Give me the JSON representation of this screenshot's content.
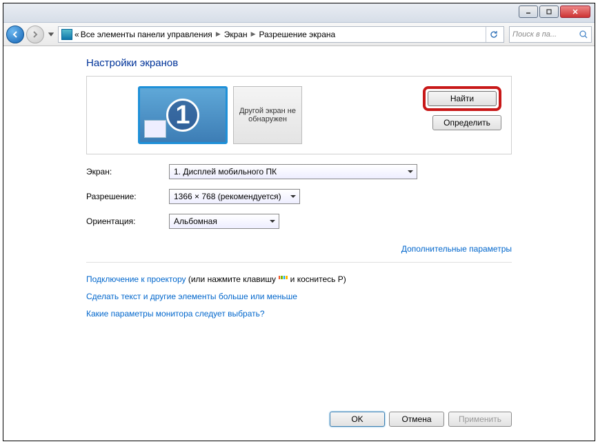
{
  "breadcrumb": {
    "root_marker": "«",
    "item1": "Все элементы панели управления",
    "item2": "Экран",
    "item3": "Разрешение экрана"
  },
  "search": {
    "placeholder": "Поиск в па..."
  },
  "page_title": "Настройки экранов",
  "display_area": {
    "monitor_number": "1",
    "other_screen": "Другой экран не обнаружен",
    "find_btn": "Найти",
    "identify_btn": "Определить"
  },
  "form": {
    "screen_label": "Экран:",
    "screen_value": "1. Дисплей мобильного ПК",
    "resolution_label": "Разрешение:",
    "resolution_value": "1366 × 768 (рекомендуется)",
    "orientation_label": "Ориентация:",
    "orientation_value": "Альбомная"
  },
  "advanced_link": "Дополнительные параметры",
  "links": {
    "projector_pre": "Подключение к проектору",
    "projector_post": " (или нажмите клавишу ",
    "projector_end": " и коснитесь P)",
    "text_size": "Сделать текст и другие элементы больше или меньше",
    "which_monitor": "Какие параметры монитора следует выбрать?"
  },
  "footer": {
    "ok": "OK",
    "cancel": "Отмена",
    "apply": "Применить"
  }
}
